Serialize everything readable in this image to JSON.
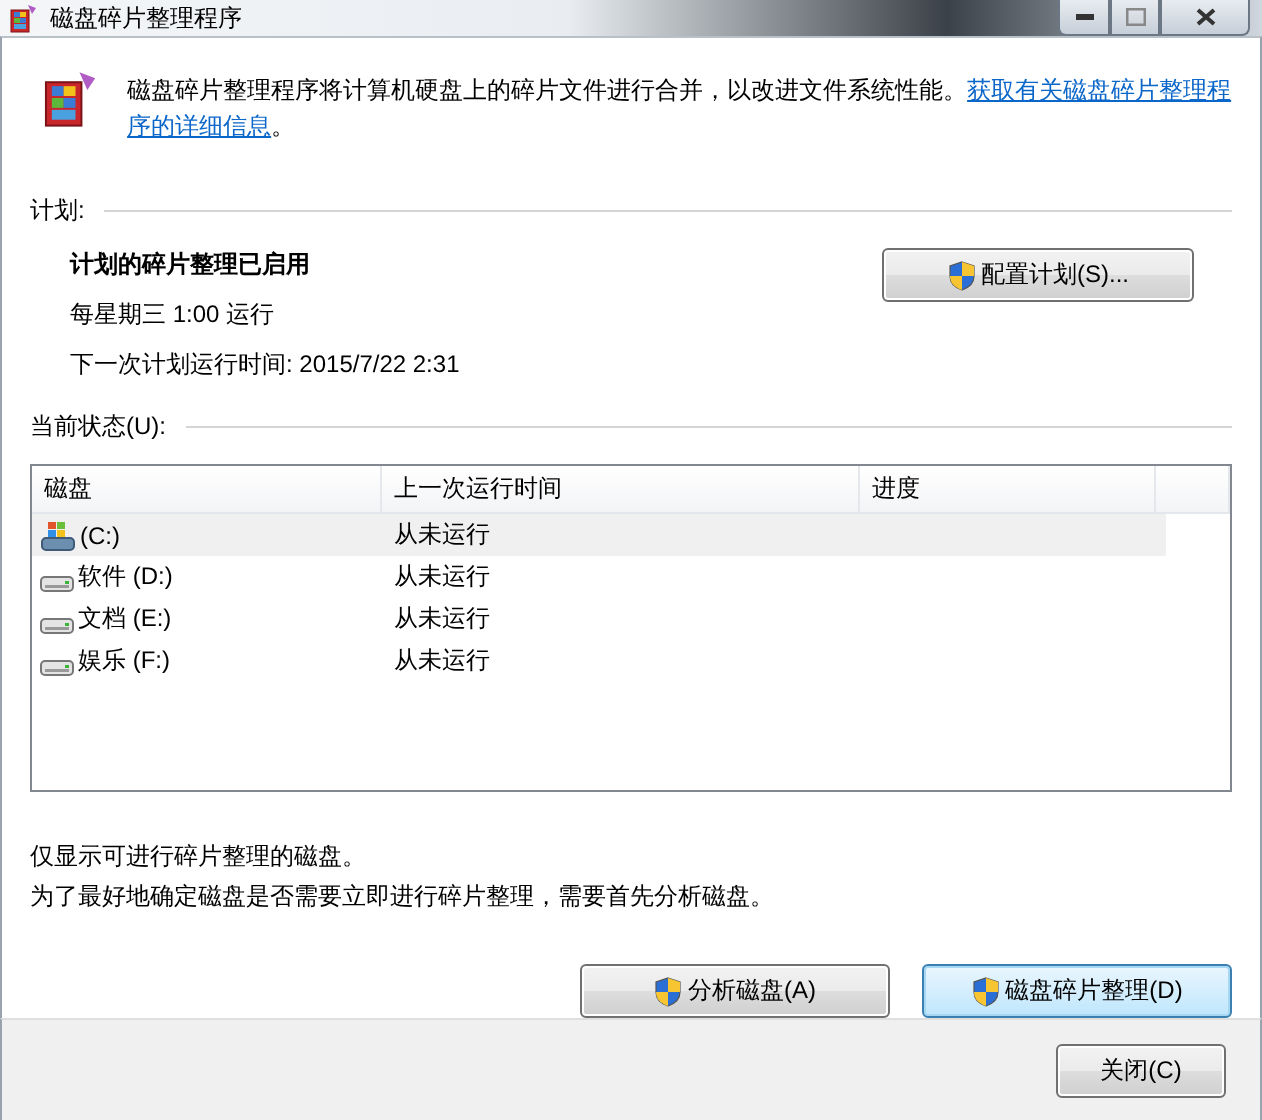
{
  "window": {
    "title": "磁盘碎片整理程序"
  },
  "intro": {
    "text": "磁盘碎片整理程序将计算机硬盘上的碎片文件进行合并，以改进文件系统性能。",
    "link_lines": [
      "获取有关磁盘碎片整理程",
      "序的详细信息"
    ],
    "tail": "。"
  },
  "schedule": {
    "heading": "计划:",
    "status": "计划的碎片整理已启用",
    "frequency": "每星期三  1:00 运行",
    "next_run": "下一次计划运行时间: 2015/7/22 2:31",
    "button": "配置计划(S)..."
  },
  "current_status": {
    "heading": "当前状态(U):",
    "columns": [
      "磁盘",
      "上一次运行时间",
      "进度"
    ],
    "rows": [
      {
        "kind": "system",
        "disk": "(C:)",
        "last_run": "从未运行",
        "selected": true
      },
      {
        "kind": "drive",
        "disk": "软件 (D:)",
        "last_run": "从未运行",
        "selected": false
      },
      {
        "kind": "drive",
        "disk": "文档 (E:)",
        "last_run": "从未运行",
        "selected": false
      },
      {
        "kind": "drive",
        "disk": "娱乐 (F:)",
        "last_run": "从未运行",
        "selected": false
      }
    ]
  },
  "notes": [
    "仅显示可进行碎片整理的磁盘。",
    "为了最好地确定磁盘是否需要立即进行碎片整理，需要首先分析磁盘。"
  ],
  "actions": [
    {
      "label": "分析磁盘(A)",
      "default": false
    },
    {
      "label": "磁盘碎片整理(D)",
      "default": true
    }
  ],
  "footer": {
    "close": "关闭(C)"
  }
}
